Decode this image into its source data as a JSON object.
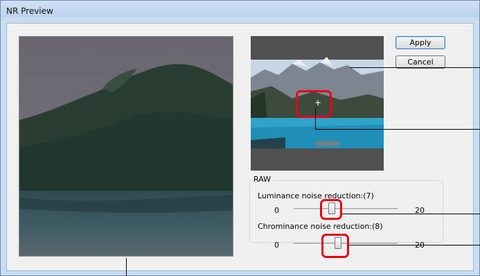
{
  "window": {
    "title": "NR Preview"
  },
  "buttons": {
    "apply": "Apply",
    "cancel": "Cancel"
  },
  "raw": {
    "group_label": "RAW",
    "luminance": {
      "label": "Luminance noise reduction:(7)",
      "min": "0",
      "max": "20",
      "value": 7
    },
    "chrominance": {
      "label": "Chrominance noise reduction:(8)",
      "min": "0",
      "max": "20",
      "value": 8
    }
  },
  "colors": {
    "callout": "#e60012",
    "water": "#1f8fb8",
    "forest": "#1f3a2c"
  }
}
